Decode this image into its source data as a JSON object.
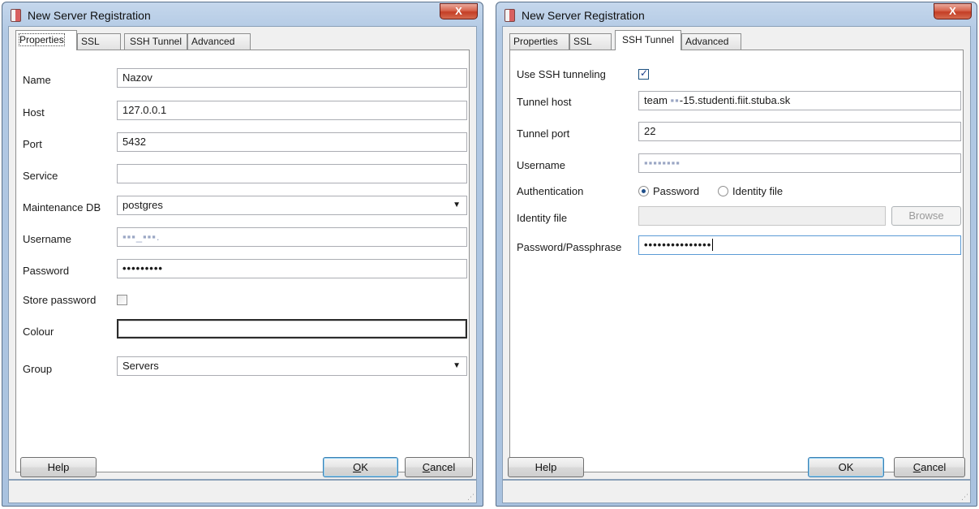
{
  "left": {
    "title": "New Server Registration",
    "close_label": "X",
    "tabs": [
      {
        "label": "Properties"
      },
      {
        "label": "SSL"
      },
      {
        "label": "SSH Tunnel"
      },
      {
        "label": "Advanced"
      }
    ],
    "fields": {
      "name": {
        "label": "Name",
        "value": "Nazov"
      },
      "host": {
        "label": "Host",
        "value": "127.0.0.1"
      },
      "port": {
        "label": "Port",
        "value": "5432"
      },
      "service": {
        "label": "Service",
        "value": ""
      },
      "maintenance_db": {
        "label": "Maintenance DB",
        "value": "postgres"
      },
      "username": {
        "label": "Username",
        "value": "▪▪▪_▪▪▪."
      },
      "password": {
        "label": "Password",
        "value": "•••••••••"
      },
      "store_password": {
        "label": "Store password",
        "checked": false
      },
      "colour": {
        "label": "Colour",
        "value": ""
      },
      "group": {
        "label": "Group",
        "value": "Servers"
      }
    },
    "buttons": {
      "help": "Help",
      "ok": "OK",
      "cancel": "Cancel"
    }
  },
  "right": {
    "title": "New Server Registration",
    "close_label": "X",
    "tabs": [
      {
        "label": "Properties"
      },
      {
        "label": "SSL"
      },
      {
        "label": "SSH Tunnel"
      },
      {
        "label": "Advanced"
      }
    ],
    "fields": {
      "use_ssh": {
        "label": "Use SSH tunneling",
        "checked": true
      },
      "tunnel_host": {
        "label": "Tunnel host",
        "value_prefix": "team ",
        "value_blurred": "▪▪",
        "value_suffix": "-15.studenti.fiit.stuba.sk"
      },
      "tunnel_port": {
        "label": "Tunnel port",
        "value": "22"
      },
      "username": {
        "label": "Username",
        "value": "▪▪▪▪▪▪▪▪"
      },
      "authentication": {
        "label": "Authentication",
        "options": [
          "Password",
          "Identity file"
        ],
        "selected": "Password"
      },
      "identity_file": {
        "label": "Identity file",
        "value": "",
        "browse": "Browse"
      },
      "passphrase": {
        "label": "Password/Passphrase",
        "value": "•••••••••••••••"
      }
    },
    "buttons": {
      "help": "Help",
      "ok": "OK",
      "cancel": "Cancel"
    }
  }
}
